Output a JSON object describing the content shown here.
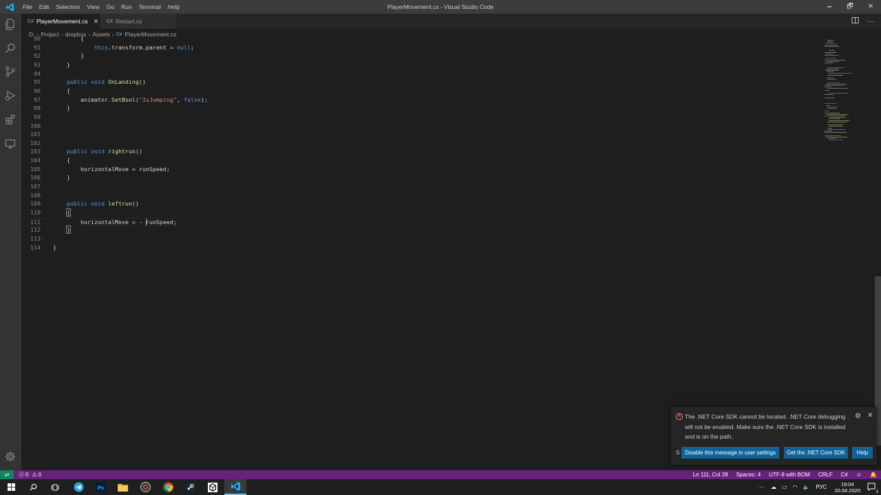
{
  "window": {
    "title": "PlayerMovement.cs - Visual Studio Code",
    "minimize": "🗕",
    "maximize": "🗗",
    "close": "✕"
  },
  "menu": [
    "File",
    "Edit",
    "Selection",
    "View",
    "Go",
    "Run",
    "Terminal",
    "Help"
  ],
  "tabs": [
    {
      "label": "PlayerMovement.cs",
      "icon": "C#",
      "close": "✕"
    },
    {
      "label": "Restart.cs",
      "icon": "C#"
    }
  ],
  "breadcrumb": [
    "D:",
    "Project",
    "dropbox",
    "Assets",
    "PlayerMovement.cs"
  ],
  "breadcrumb_icon": "C#",
  "code_lines": [
    {
      "n": "90",
      "t": "        {"
    },
    {
      "n": "91",
      "t": "            this.transform.parent = null;"
    },
    {
      "n": "92",
      "t": "        }"
    },
    {
      "n": "93",
      "t": "    }"
    },
    {
      "n": "94",
      "t": ""
    },
    {
      "n": "95",
      "t": "    public void OnLanding()"
    },
    {
      "n": "96",
      "t": "    {"
    },
    {
      "n": "97",
      "t": "        animator.SetBool(\"IsJumping\", false);"
    },
    {
      "n": "98",
      "t": "    }"
    },
    {
      "n": "99",
      "t": ""
    },
    {
      "n": "100",
      "t": ""
    },
    {
      "n": "101",
      "t": ""
    },
    {
      "n": "102",
      "t": ""
    },
    {
      "n": "103",
      "t": "    public void rightrun()"
    },
    {
      "n": "104",
      "t": "    {"
    },
    {
      "n": "105",
      "t": "        horizontalMove = runSpeed;"
    },
    {
      "n": "106",
      "t": "    }"
    },
    {
      "n": "107",
      "t": ""
    },
    {
      "n": "108",
      "t": ""
    },
    {
      "n": "109",
      "t": "    public void leftrun()"
    },
    {
      "n": "110",
      "t": "    {"
    },
    {
      "n": "111",
      "t": "        horizontalMove = - runSpeed;"
    },
    {
      "n": "112",
      "t": "    }"
    },
    {
      "n": "113",
      "t": ""
    },
    {
      "n": "114",
      "t": "}"
    }
  ],
  "notification": {
    "message": "The .NET Core SDK cannot be located. .NET Core debugging will not be enabled. Make sure the .NET Core SDK is installed and is on the path.",
    "source": "S",
    "buttons": [
      "Disable this message in user settings",
      "Get the .NET Core SDK",
      "Help"
    ]
  },
  "statusbar": {
    "errors": "0",
    "warnings": "0",
    "position": "Ln 111, Col 28",
    "spaces": "Spaces: 4",
    "encoding": "UTF-8 with BOM",
    "eol": "CRLF",
    "language": "C#"
  },
  "taskbar": {
    "lang": "РУС",
    "time": "19:04",
    "date": "20.04.2020",
    "notifications": "3"
  },
  "colors": {
    "accent": "#68217a",
    "button": "#0e639c",
    "remote": "#16825d"
  }
}
